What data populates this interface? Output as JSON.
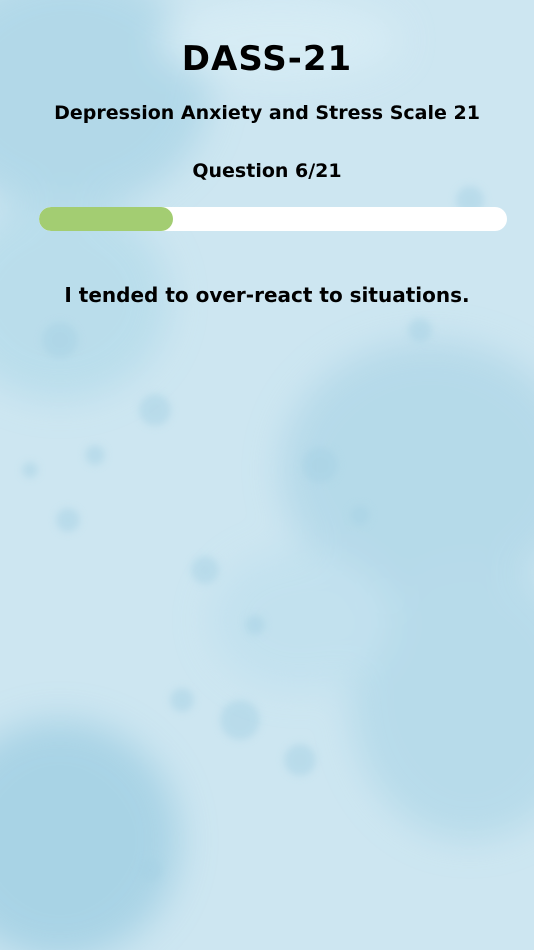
{
  "header": {
    "title": "DASS-21",
    "subtitle": "Depression Anxiety and Stress Scale 21"
  },
  "progress": {
    "label": "Question 6/21",
    "current": 6,
    "total": 21,
    "fraction": 0.2857
  },
  "question": {
    "text": "I tended to over-react to situations."
  },
  "colors": {
    "background": "#cde6f1",
    "progress_fill": "#a3cd72",
    "progress_track": "#ffffff",
    "text": "#000000"
  }
}
